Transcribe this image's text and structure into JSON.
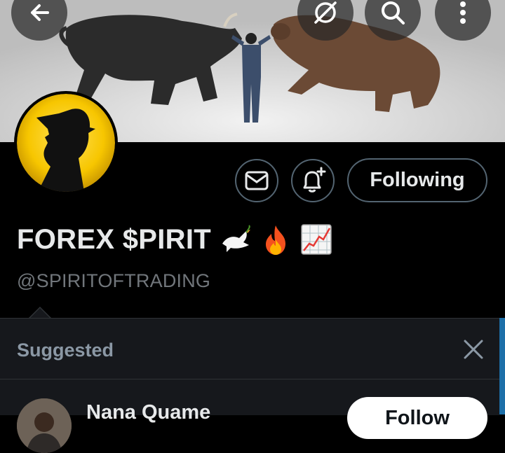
{
  "header": {
    "back_icon": "arrow-left-icon",
    "grok_icon": "grok-icon",
    "search_icon": "search-icon",
    "more_icon": "more-vertical-icon"
  },
  "profile": {
    "display_name": "FOREX $PIRIT",
    "name_emojis": [
      "dove-icon",
      "fire-icon",
      "chart-increasing-icon"
    ],
    "handle": "@SPIRITOFTRADING",
    "message_icon": "mail-icon",
    "notify_icon": "bell-plus-icon",
    "following_label": "Following"
  },
  "suggested": {
    "title": "Suggested",
    "close_icon": "close-icon",
    "items": [
      {
        "name": "Nana Quame",
        "follow_label": "Follow"
      }
    ]
  },
  "colors": {
    "background": "#000000",
    "panel": "#16181c",
    "border": "#536471",
    "muted_text": "#71767b",
    "avatar_yellow": "#f7c600"
  }
}
